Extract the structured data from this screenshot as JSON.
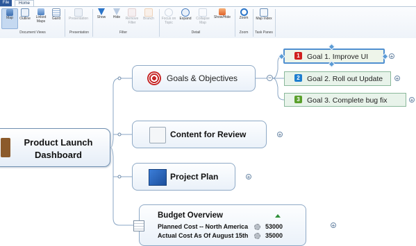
{
  "tabs": {
    "file": "File",
    "home": "Home"
  },
  "ribbon": {
    "buttons": [
      {
        "label": "Map",
        "icon": "map-view-icon"
      },
      {
        "label": "Outline",
        "icon": "outline-view-icon"
      },
      {
        "label": "Linked Maps",
        "icon": "linked-maps-icon"
      },
      {
        "label": "Gantt",
        "icon": "gantt-icon"
      },
      {
        "label": "Presentation",
        "icon": "presentation-icon"
      },
      {
        "label": "Show",
        "icon": "filter-show-icon"
      },
      {
        "label": "Hide",
        "icon": "filter-hide-icon"
      },
      {
        "label": "Remove Filter",
        "icon": "remove-filter-icon"
      },
      {
        "label": "Branch",
        "icon": "branch-icon"
      },
      {
        "label": "Focus on Topic",
        "icon": "focus-topic-icon"
      },
      {
        "label": "Expand",
        "icon": "expand-icon"
      },
      {
        "label": "Collapse Map",
        "icon": "collapse-map-icon"
      },
      {
        "label": "Show/Hide",
        "icon": "show-hide-icon"
      },
      {
        "label": "Zoom",
        "icon": "zoom-icon"
      },
      {
        "label": "Map Index",
        "icon": "map-index-icon"
      }
    ],
    "groups": [
      "Document Views",
      "Presentation",
      "Filter",
      "Detail",
      "Zoom",
      "Task Panes"
    ]
  },
  "map": {
    "central": "Product Launch Dashboard",
    "central_line1": "Product Launch",
    "central_line2": "Dashboard",
    "topics": {
      "goals": "Goals & Objectives",
      "content": "Content for Review",
      "plan": "Project Plan",
      "budget": "Budget Overview"
    },
    "goals": [
      {
        "badge": "1",
        "label": "Goal 1. Improve UI",
        "color": "#d0201f"
      },
      {
        "badge": "2",
        "label": "Goal 2. Roll out Update",
        "color": "#1f7fd0"
      },
      {
        "badge": "3",
        "label": "Goal 3. Complete bug fix",
        "color": "#5aa02c"
      }
    ],
    "budget_rows": [
      {
        "label": "Planned Cost -- North America",
        "value": "53000"
      },
      {
        "label": "Actual Cost As Of August 15th",
        "value": "35000"
      }
    ]
  },
  "colors": {
    "accent": "#2b579a",
    "topic_border": "#8ea9c6",
    "subtopic_fill": "#e8f3ea"
  }
}
